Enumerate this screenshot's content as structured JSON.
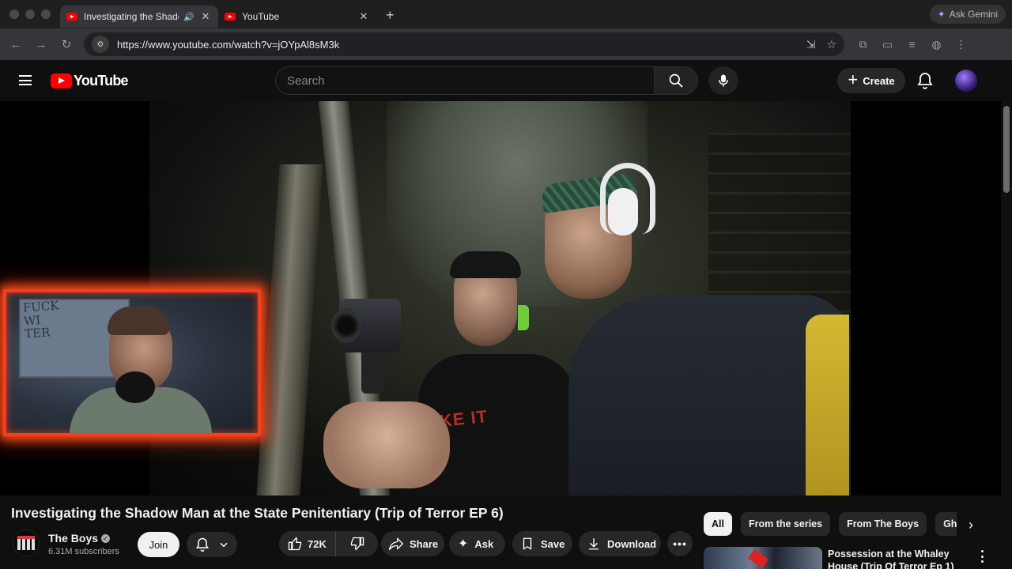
{
  "browser": {
    "tabs": [
      {
        "title": "Investigating the Shadow",
        "active": true,
        "audio": true,
        "icon": "youtube-favicon"
      },
      {
        "title": "YouTube",
        "active": false,
        "audio": false,
        "icon": "youtube-favicon"
      }
    ],
    "url": "https://www.youtube.com/watch?v=jOYpAl8sM3k",
    "gemini_label": "Ask Gemini",
    "nav_icons": [
      "back-arrow-icon",
      "forward-arrow-icon",
      "reload-icon"
    ],
    "extension_icons": [
      "puzzle-icon",
      "cast-icon",
      "media-control-icon",
      "profile-icon",
      "more-vertical-icon"
    ]
  },
  "youtube_header": {
    "logo_text": "YouTube",
    "search_placeholder": "Search",
    "create_label": "Create",
    "accent_color": "#ff0000"
  },
  "video": {
    "title": "Investigating the Shadow Man at the State Penitentiary (Trip of Terror EP 6)",
    "facecam_board_text": "FUCK\nWI\nTER",
    "shirt_text": "AKE IT"
  },
  "channel": {
    "name": "The Boys",
    "subscribers": "6.31M subscribers",
    "join_label": "Join"
  },
  "actions": {
    "likes": "72K",
    "share_label": "Share",
    "ask_label": "Ask",
    "save_label": "Save",
    "download_label": "Download"
  },
  "chips": [
    {
      "label": "All",
      "active": true
    },
    {
      "label": "From the series",
      "active": false
    },
    {
      "label": "From The Boys",
      "active": false
    },
    {
      "label": "Ghos",
      "active": false
    }
  ],
  "recommendation": {
    "title": "Possession at the Whaley House (Trip Of Terror Ep 1)"
  }
}
